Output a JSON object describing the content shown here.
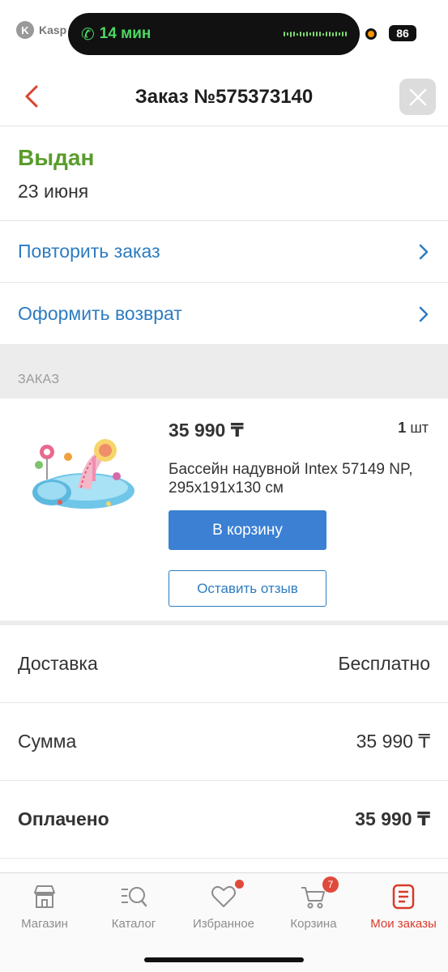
{
  "status_bar": {
    "app_name": "Kasp",
    "call_time": "14 мин",
    "battery": "86"
  },
  "header": {
    "title": "Заказ №575373140"
  },
  "order_status": {
    "status": "Выдан",
    "date": "23 июня"
  },
  "actions": {
    "repeat_label": "Повторить заказ",
    "return_label": "Оформить возврат"
  },
  "section": {
    "order_label": "ЗАКАЗ"
  },
  "item": {
    "price": "35 990 ₸",
    "qty_number": "1",
    "qty_unit": "шт",
    "name": "Бассейн надувной Intex 57149 NP, 295x191x130 см",
    "cart_button": "В корзину",
    "review_button": "Оставить отзыв",
    "image_icon": "inflatable-pool-image"
  },
  "summary": {
    "delivery_label": "Доставка",
    "delivery_value": "Бесплатно",
    "sum_label": "Сумма",
    "sum_value": "35 990 ₸",
    "paid_label": "Оплачено",
    "paid_value": "35 990 ₸"
  },
  "tabs": [
    {
      "label": "Магазин",
      "icon": "store-icon"
    },
    {
      "label": "Каталог",
      "icon": "catalog-search-icon"
    },
    {
      "label": "Избранное",
      "icon": "heart-icon"
    },
    {
      "label": "Корзина",
      "icon": "cart-icon",
      "badge": "7"
    },
    {
      "label": "Мои заказы",
      "icon": "orders-icon"
    }
  ],
  "colors": {
    "accent_blue": "#2d7cc1",
    "status_green": "#5a9c2c",
    "active_tab_red": "#d93a2b",
    "badge_red": "#e04a3c"
  }
}
